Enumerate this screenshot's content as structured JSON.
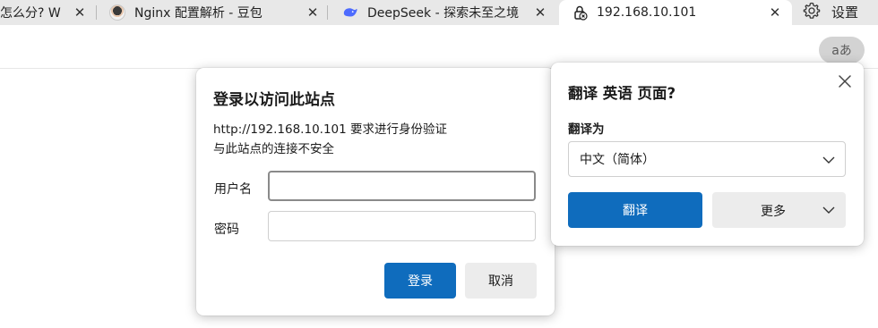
{
  "tabs": [
    {
      "title": "怎么分? W",
      "close": "✕"
    },
    {
      "title": "Nginx 配置解析 - 豆包",
      "close": "✕"
    },
    {
      "title": "DeepSeek - 探索未至之境",
      "close": "✕"
    },
    {
      "title": "192.168.10.101",
      "close": "✕",
      "active": true
    }
  ],
  "settings_label": "设置",
  "toolbar": {
    "read_aloud_label": "aあ"
  },
  "login": {
    "title": "登录以访问此站点",
    "message_line1": "http://192.168.10.101 要求进行身份验证",
    "message_line2": "与此站点的连接不安全",
    "username_label": "用户名",
    "username_value": "",
    "password_label": "密码",
    "password_value": "",
    "login_button": "登录",
    "cancel_button": "取消"
  },
  "translate": {
    "title": "翻译 英语 页面?",
    "target_label": "翻译为",
    "target_value": "中文（简体）",
    "translate_button": "翻译",
    "more_button": "更多"
  },
  "icons": {
    "tab2_favicon": "avatar-icon",
    "tab3_favicon": "deepseek-whale-icon",
    "tab4_favicon": "insecure-lock-icon",
    "settings": "gear-icon",
    "popup_close": "close-icon",
    "dropdown": "chevron-down-icon"
  },
  "colors": {
    "primary": "#0f6cbd",
    "tabstrip": "#e8e8e8",
    "secondary_button": "#ececec"
  }
}
